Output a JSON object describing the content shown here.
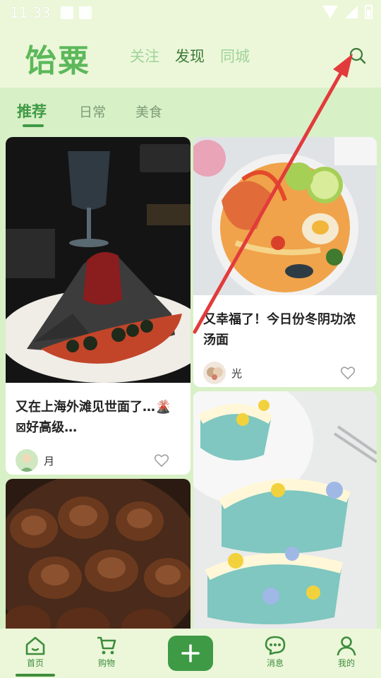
{
  "status_bar": {
    "time": "11:33"
  },
  "header": {
    "logo": "饴粟",
    "tabs": [
      {
        "label": "关注",
        "active": false
      },
      {
        "label": "发现",
        "active": true
      },
      {
        "label": "同城",
        "active": false
      }
    ]
  },
  "sub_tabs": [
    {
      "label": "推荐",
      "active": true
    },
    {
      "label": "日常",
      "active": false
    },
    {
      "label": "美食",
      "active": false
    }
  ],
  "feed": {
    "cards": [
      {
        "title": "又在上海外滩见世面了…🌋⊠好高级…",
        "author": "月",
        "liked": false
      },
      {
        "title": "又幸福了！今日份冬阴功浓汤面",
        "author": "光",
        "liked": false
      },
      {
        "title": "",
        "author": "",
        "liked": false
      },
      {
        "title": "",
        "author": "",
        "liked": false
      }
    ]
  },
  "bottom_nav": {
    "items": [
      {
        "label": "首页",
        "icon": "home-icon",
        "active": true
      },
      {
        "label": "购物",
        "icon": "cart-icon",
        "active": false
      },
      {
        "label": "",
        "icon": "plus-icon",
        "active": false
      },
      {
        "label": "消息",
        "icon": "message-icon",
        "active": false
      },
      {
        "label": "我的",
        "icon": "profile-icon",
        "active": false
      }
    ]
  },
  "colors": {
    "accent": "#3f9a45",
    "logo": "#5cb85a",
    "background": "#d8f0c6",
    "annotation_arrow": "#e23b3b"
  }
}
